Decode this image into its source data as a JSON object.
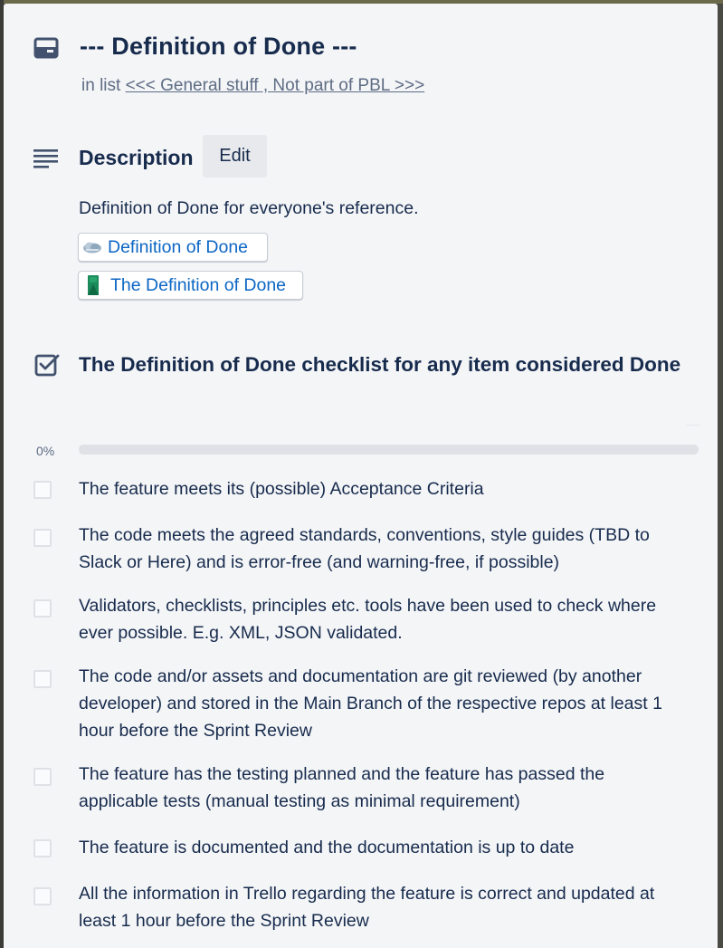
{
  "card": {
    "title": "--- Definition of Done ---",
    "in_list_prefix": "in list",
    "list_name": "<<< General stuff , Not part of PBL >>>"
  },
  "description": {
    "heading": "Description",
    "edit_label": "Edit",
    "text": "Definition of Done for everyone's reference.",
    "links": [
      {
        "label": "Definition of Done",
        "icon": "cloud-favicon-icon"
      },
      {
        "label": "The Definition of Done",
        "icon": "book-favicon-icon"
      }
    ]
  },
  "checklist": {
    "title": "The Definition of Done checklist for any item considered Done",
    "progress_label": "0%",
    "progress_value": 0,
    "items": [
      {
        "text": "The feature meets its (possible) Acceptance Criteria",
        "checked": false
      },
      {
        "text": "The code meets the agreed standards, conventions, style guides (TBD to Slack or Here) and is error-free (and warning-free, if possible)",
        "checked": false
      },
      {
        "text": "Validators, checklists, principles etc. tools have been used to check where ever possible. E.g. XML, JSON validated.",
        "checked": false
      },
      {
        "text": "The code and/or assets and documentation are git reviewed (by another developer) and stored in the Main Branch of the respective repos at least 1 hour before the Sprint Review",
        "checked": false
      },
      {
        "text": "The feature has the testing planned and the feature has passed the applicable tests (manual testing as minimal requirement)",
        "checked": false
      },
      {
        "text": "The feature is documented and the documentation is up to date",
        "checked": false
      },
      {
        "text": "All the information in Trello regarding the feature is correct and updated at least 1 hour before the Sprint Review",
        "checked": false
      }
    ]
  },
  "colors": {
    "card_background": "#f4f5f7",
    "text": "#172b4d",
    "muted": "#5e6c84",
    "link": "#0c66c4",
    "progress_track": "#dfe1e6"
  },
  "icons": {
    "card": "card-icon",
    "description": "description-lines-icon",
    "checklist": "checklist-icon"
  }
}
